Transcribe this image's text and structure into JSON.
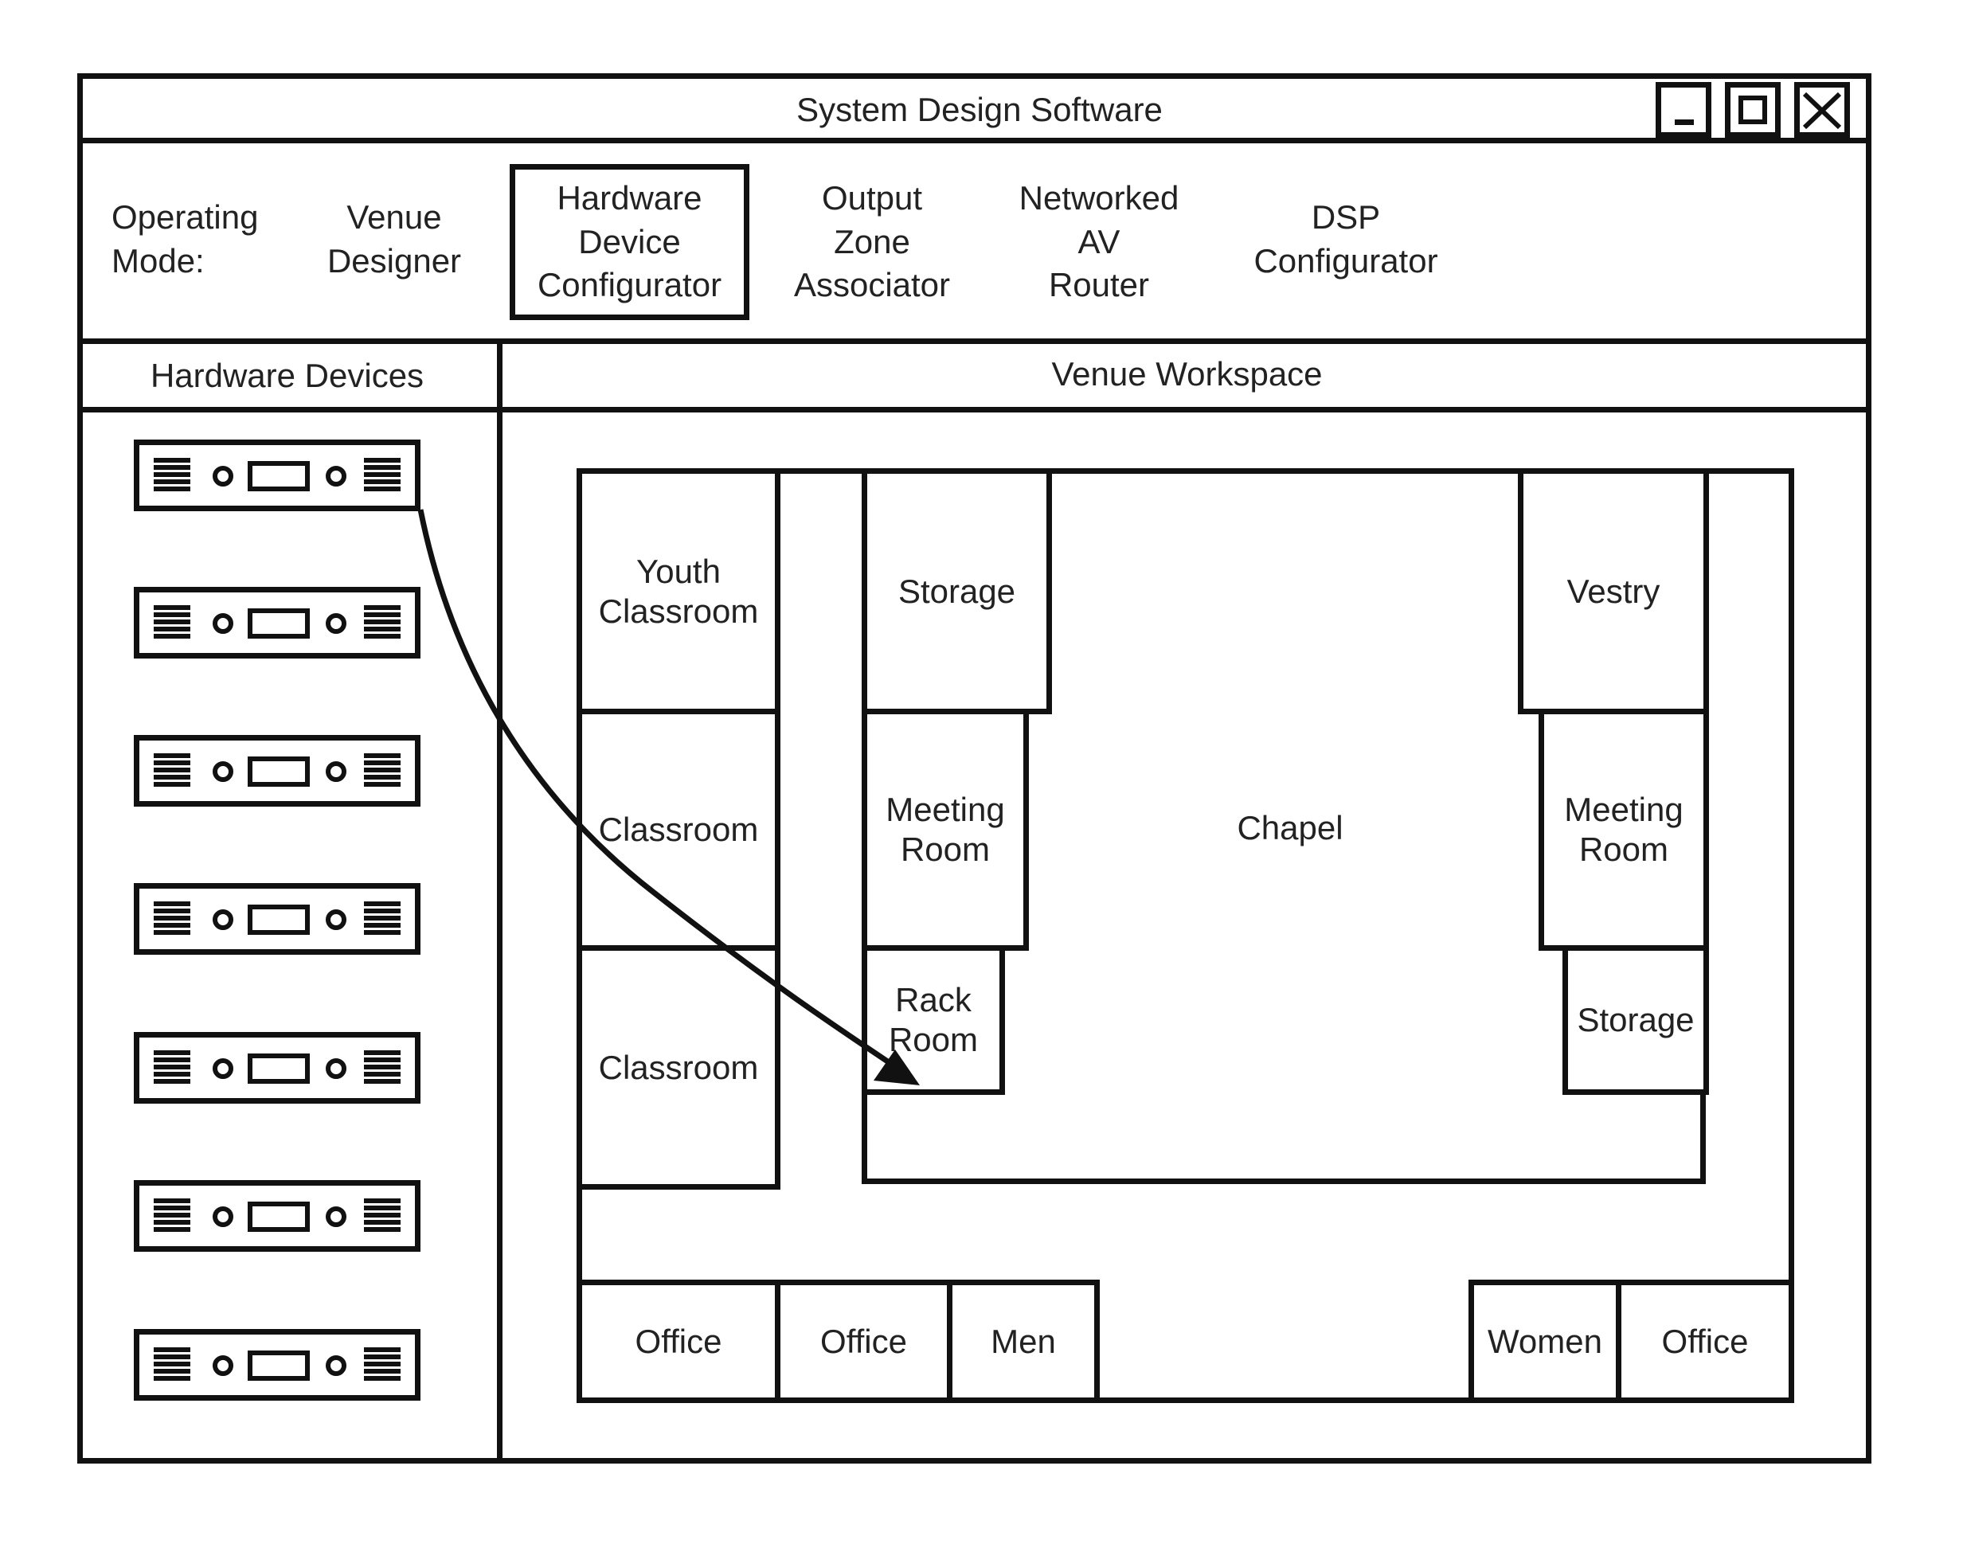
{
  "window": {
    "title": "System Design Software",
    "controls": [
      {
        "name": "minimize",
        "icon": "minimize-icon"
      },
      {
        "name": "maximize",
        "icon": "maximize-icon"
      },
      {
        "name": "close",
        "icon": "close-icon"
      }
    ]
  },
  "toolbar": {
    "operating_mode_label": "Operating\nMode:",
    "modes": [
      {
        "label": "Venue\nDesigner",
        "selected": false
      },
      {
        "label": "Hardware\nDevice\nConfigurator",
        "selected": true
      },
      {
        "label": "Output\nZone\nAssociator",
        "selected": false
      },
      {
        "label": "Networked\nAV\nRouter",
        "selected": false
      },
      {
        "label": "DSP\nConfigurator",
        "selected": false
      }
    ]
  },
  "sidebar": {
    "title": "Hardware Devices",
    "device_count": 7,
    "device_icon": "rack-mount-device-icon"
  },
  "workspace": {
    "title": "Venue Workspace",
    "rooms": [
      {
        "id": "youth-classroom",
        "label": "Youth\nClassroom"
      },
      {
        "id": "classroom-1",
        "label": "Classroom"
      },
      {
        "id": "classroom-2",
        "label": "Classroom"
      },
      {
        "id": "storage-left",
        "label": "Storage"
      },
      {
        "id": "meeting-room-left",
        "label": "Meeting\nRoom"
      },
      {
        "id": "rack-room",
        "label": "Rack\nRoom"
      },
      {
        "id": "chapel",
        "label": "Chapel"
      },
      {
        "id": "vestry",
        "label": "Vestry"
      },
      {
        "id": "meeting-room-right",
        "label": "Meeting\nRoom"
      },
      {
        "id": "storage-right",
        "label": "Storage"
      },
      {
        "id": "office-1",
        "label": "Office"
      },
      {
        "id": "office-2",
        "label": "Office"
      },
      {
        "id": "men",
        "label": "Men"
      },
      {
        "id": "women",
        "label": "Women"
      },
      {
        "id": "office-3",
        "label": "Office"
      }
    ],
    "drag": {
      "from": "hardware-device-1",
      "to": "rack-room"
    }
  }
}
